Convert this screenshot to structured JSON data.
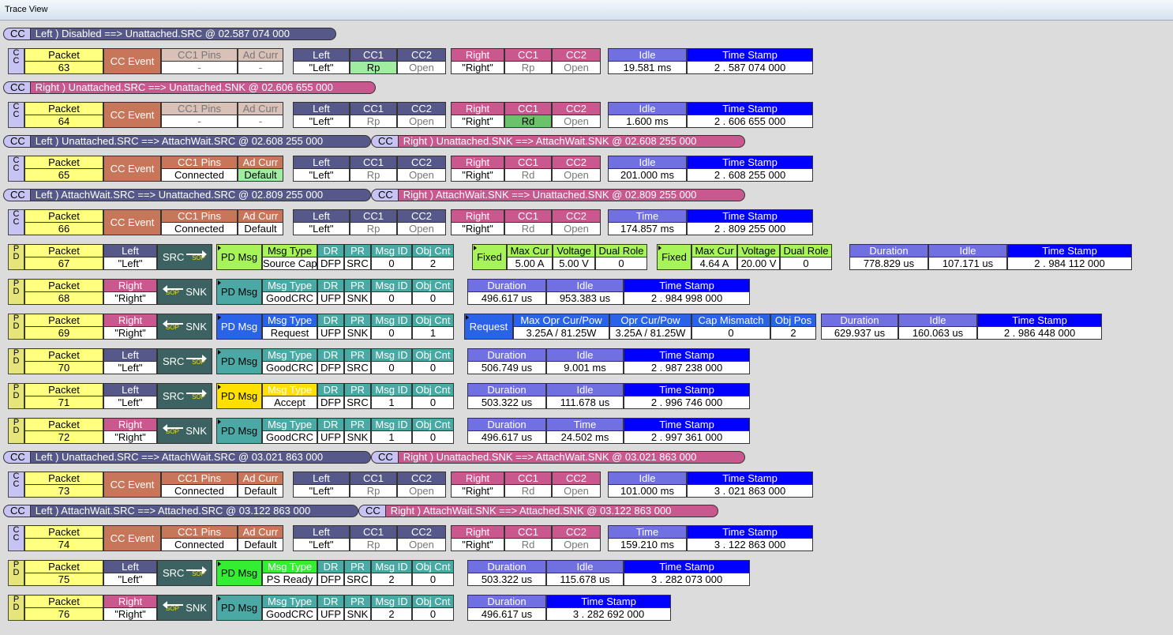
{
  "window_title": "Trace View",
  "cc_tag": "CC",
  "pd_tag": "PD",
  "packet_label": "Packet",
  "cc_event_label": "CC Event",
  "pd_msg_label": "PD Msg",
  "sop_label": "SOP",
  "headers": {
    "cc1_pins": "CC1 Pins",
    "ad_curr": "Ad Curr",
    "left": "Left",
    "right": "Right",
    "cc1": "CC1",
    "cc2": "CC2",
    "idle": "Idle",
    "time": "Time",
    "time_stamp": "Time Stamp",
    "duration": "Duration",
    "msg_type": "Msg Type",
    "dr": "DR",
    "pr": "PR",
    "msg_id": "Msg ID",
    "obj_cnt": "Obj Cnt",
    "fixed": "Fixed",
    "max_cur": "Max Cur",
    "voltage": "Voltage",
    "dual_role": "Dual Role",
    "request": "Request",
    "max_opr_cur_pow": "Max Opr Cur/Pow",
    "opr_cur_pow": "Opr Cur/Pow",
    "cap_mismatch": "Cap Mismatch",
    "obj_pos": "Obj Pos"
  },
  "transitions": [
    {
      "pills": [
        {
          "side": "left",
          "text": "Left )  Disabled ==> Unattached.SRC @ 02.587 074 000"
        }
      ]
    },
    {
      "pills": [
        {
          "side": "right",
          "text": "Right )  Unattached.SRC ==> Unattached.SNK @ 02.606 655 000"
        }
      ]
    },
    {
      "pills": [
        {
          "side": "left",
          "text": "Left )  Unattached.SRC ==> AttachWait.SRC @ 02.608 255 000"
        },
        {
          "side": "right",
          "text": "Right )  Unattached.SNK ==> AttachWait.SNK @ 02.608 255 000"
        }
      ]
    },
    {
      "pills": [
        {
          "side": "left",
          "text": "Left )  AttachWait.SRC ==> Unattached.SRC @ 02.809 255 000"
        },
        {
          "side": "right",
          "text": "Right )  AttachWait.SNK ==> Unattached.SNK @ 02.809 255 000"
        }
      ]
    },
    {
      "pills": [
        {
          "side": "left",
          "text": "Left )  Unattached.SRC ==> AttachWait.SRC @ 03.021 863 000"
        },
        {
          "side": "right",
          "text": "Right )  Unattached.SNK ==> AttachWait.SNK @ 03.021 863 000"
        }
      ]
    },
    {
      "pills": [
        {
          "side": "left",
          "text": "Left )  AttachWait.SRC ==> Attached.SRC @ 03.122 863 000"
        },
        {
          "side": "right",
          "text": "Right )  AttachWait.SNK ==> Attached.SNK @ 03.122 863 000"
        }
      ]
    }
  ],
  "cc_packets": [
    {
      "num": "63",
      "cc1_pins": "-",
      "ad_curr": "-",
      "pins_disabled": true,
      "left": "\"Left\"",
      "l_cc1": "Rp",
      "l_cc1_hl": "green",
      "l_cc2": "Open",
      "right": "\"Right\"",
      "r_cc1": "Rp",
      "r_cc1_hl": "",
      "r_cc2": "Open",
      "idle_label": "Idle",
      "idle": "19.581 ms",
      "ts": "2 . 587 074 000"
    },
    {
      "num": "64",
      "cc1_pins": "-",
      "ad_curr": "-",
      "pins_disabled": true,
      "left": "\"Left\"",
      "l_cc1": "Rp",
      "l_cc1_hl": "",
      "l_cc2": "Open",
      "right": "\"Right\"",
      "r_cc1": "Rd",
      "r_cc1_hl": "dark",
      "r_cc2": "Open",
      "idle_label": "Idle",
      "idle": "1.600 ms",
      "ts": "2 . 606 655 000"
    },
    {
      "num": "65",
      "cc1_pins": "Connected",
      "ad_curr": "Default",
      "ad_hl": "green",
      "pins_disabled": false,
      "left": "\"Left\"",
      "l_cc1": "Rp",
      "l_cc1_hl": "",
      "l_cc2": "Open",
      "right": "\"Right\"",
      "r_cc1": "Rd",
      "r_cc1_hl": "",
      "r_cc2": "Open",
      "idle_label": "Idle",
      "idle": "201.000 ms",
      "ts": "2 . 608 255 000"
    },
    {
      "num": "66",
      "cc1_pins": "Connected",
      "ad_curr": "Default",
      "pins_disabled": false,
      "left": "\"Left\"",
      "l_cc1": "Rp",
      "l_cc1_hl": "",
      "l_cc2": "Open",
      "right": "\"Right\"",
      "r_cc1": "Rd",
      "r_cc1_hl": "",
      "r_cc2": "Open",
      "idle_label": "Time",
      "idle": "174.857 ms",
      "ts": "2 . 809 255 000"
    },
    {
      "num": "73",
      "cc1_pins": "Connected",
      "ad_curr": "Default",
      "pins_disabled": false,
      "left": "\"Left\"",
      "l_cc1": "Rp",
      "l_cc1_hl": "",
      "l_cc2": "Open",
      "right": "\"Right\"",
      "r_cc1": "Rd",
      "r_cc1_hl": "",
      "r_cc2": "Open",
      "idle_label": "Idle",
      "idle": "101.000 ms",
      "ts": "3 . 021 863 000"
    },
    {
      "num": "74",
      "cc1_pins": "Connected",
      "ad_curr": "Default",
      "pins_disabled": false,
      "left": "\"Left\"",
      "l_cc1": "Rp",
      "l_cc1_hl": "",
      "l_cc2": "Open",
      "right": "\"Right\"",
      "r_cc1": "Rd",
      "r_cc1_hl": "",
      "r_cc2": "Open",
      "idle_label": "Time",
      "idle": "159.210 ms",
      "ts": "3 . 122 863 000"
    }
  ],
  "pd_packets": [
    {
      "num": "67",
      "side": "Left",
      "port": "\"Left\"",
      "dir": "SRC",
      "msg_color": "#a7f45a",
      "msg_type": "Source Cap",
      "dr": "DFP",
      "pr": "SRC",
      "msg_id": "0",
      "obj_cnt": "2",
      "pdos": [
        {
          "type": "Fixed",
          "max_cur": "5.00 A",
          "voltage": "5.00 V",
          "dual_role": "0"
        },
        {
          "type": "Fixed",
          "max_cur": "4.64 A",
          "voltage": "20.00 V",
          "dual_role": "0"
        }
      ],
      "duration": "778.829 us",
      "idle_label": "Idle",
      "idle": "107.171 us",
      "ts": "2 . 984 112 000"
    },
    {
      "num": "68",
      "side": "Right",
      "port": "\"Right\"",
      "dir": "SNK",
      "msg_color": "#4aa9a4",
      "msg_type": "GoodCRC",
      "dr": "UFP",
      "pr": "SNK",
      "msg_id": "0",
      "obj_cnt": "0",
      "duration": "496.617 us",
      "idle_label": "Idle",
      "idle": "953.383 us",
      "ts": "2 . 984 998 000"
    },
    {
      "num": "69",
      "side": "Right",
      "port": "\"Right\"",
      "dir": "SNK",
      "msg_color": "#2a62e8",
      "msg_type": "Request",
      "dr": "UFP",
      "pr": "SNK",
      "msg_id": "0",
      "obj_cnt": "1",
      "request": {
        "label": "Request",
        "max_opr": "3.25A / 81.25W",
        "opr": "3.25A / 81.25W",
        "cap_mismatch": "0",
        "obj_pos": "2"
      },
      "duration": "629.937 us",
      "idle_label": "Idle",
      "idle": "160.063 us",
      "ts": "2 . 986 448 000"
    },
    {
      "num": "70",
      "side": "Left",
      "port": "\"Left\"",
      "dir": "SRC",
      "msg_color": "#4aa9a4",
      "msg_type": "GoodCRC",
      "dr": "DFP",
      "pr": "SRC",
      "msg_id": "0",
      "obj_cnt": "0",
      "duration": "506.749 us",
      "idle_label": "Idle",
      "idle": "9.001 ms",
      "ts": "2 . 987 238 000"
    },
    {
      "num": "71",
      "side": "Left",
      "port": "\"Left\"",
      "dir": "SRC",
      "msg_color": "#ffe000",
      "msg_type": "Accept",
      "dr": "DFP",
      "pr": "SRC",
      "msg_id": "1",
      "obj_cnt": "0",
      "duration": "503.322 us",
      "idle_label": "Idle",
      "idle": "111.678 us",
      "ts": "2 . 996 746 000"
    },
    {
      "num": "72",
      "side": "Right",
      "port": "\"Right\"",
      "dir": "SNK",
      "msg_color": "#4aa9a4",
      "msg_type": "GoodCRC",
      "dr": "UFP",
      "pr": "SNK",
      "msg_id": "1",
      "obj_cnt": "0",
      "duration": "496.617 us",
      "idle_label": "Time",
      "idle": "24.502 ms",
      "ts": "2 . 997 361 000"
    },
    {
      "num": "75",
      "side": "Left",
      "port": "\"Left\"",
      "dir": "SRC",
      "msg_color": "#33ee33",
      "msg_type": "PS Ready",
      "dr": "DFP",
      "pr": "SRC",
      "msg_id": "2",
      "obj_cnt": "0",
      "duration": "503.322 us",
      "idle_label": "Idle",
      "idle": "115.678 us",
      "ts": "3 . 282 073 000"
    },
    {
      "num": "76",
      "side": "Right",
      "port": "\"Right\"",
      "dir": "SNK",
      "msg_color": "#4aa9a4",
      "msg_type": "GoodCRC",
      "dr": "UFP",
      "pr": "SNK",
      "msg_id": "2",
      "obj_cnt": "0",
      "duration": "496.617 us",
      "ts": "3 . 282 692 000"
    }
  ]
}
